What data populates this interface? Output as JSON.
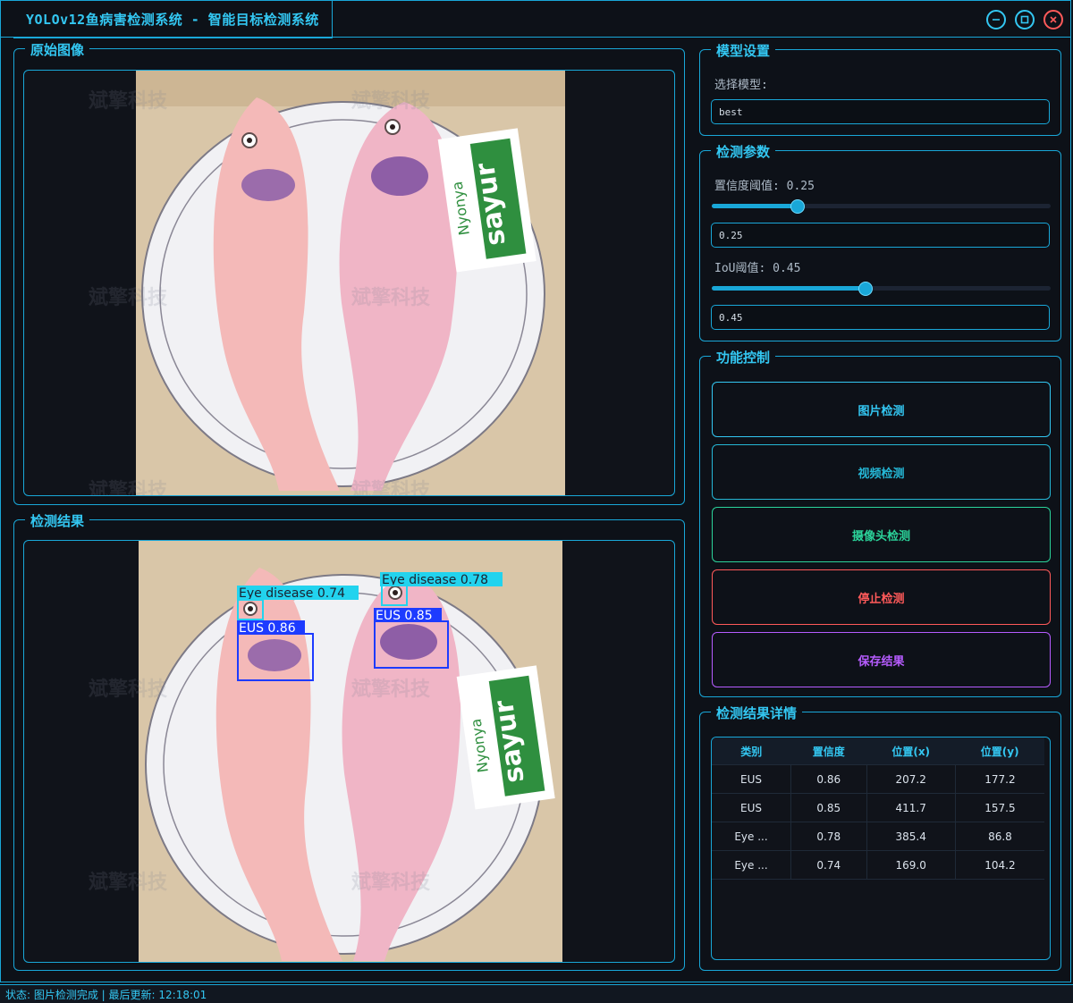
{
  "window": {
    "title": "YOLOv12鱼病害检测系统 - 智能目标检测系统"
  },
  "watermark": "斌擎科技",
  "original_panel": {
    "title": "原始图像"
  },
  "result_panel": {
    "title": "检测结果",
    "detections": [
      {
        "label": "Eye disease 0.74",
        "color": "#22d3ee"
      },
      {
        "label": "Eye disease 0.78",
        "color": "#22d3ee"
      },
      {
        "label": "EUS 0.86",
        "color": "#1d3bff"
      },
      {
        "label": "EUS 0.85",
        "color": "#1d3bff"
      }
    ]
  },
  "photo": {
    "brand_top": "Nyonya",
    "brand_bottom": "sayur"
  },
  "model_settings": {
    "title": "模型设置",
    "select_label": "选择模型:",
    "model_value": "best"
  },
  "detection_params": {
    "title": "检测参数",
    "confidence_label": "置信度阈值: 0.25",
    "confidence_value": "0.25",
    "confidence": 0.25,
    "iou_label": "IoU阈值: 0.45",
    "iou_value": "0.45",
    "iou": 0.45
  },
  "controls": {
    "title": "功能控制",
    "buttons": [
      {
        "label": "图片检测",
        "color": "#33c7f2"
      },
      {
        "label": "视频检测",
        "color": "#25b7d6"
      },
      {
        "label": "摄像头检测",
        "color": "#2bd39a"
      },
      {
        "label": "停止检测",
        "color": "#ff5a5a"
      },
      {
        "label": "保存结果",
        "color": "#b65cff"
      }
    ]
  },
  "details": {
    "title": "检测结果详情",
    "columns": [
      "类别",
      "置信度",
      "位置(x)",
      "位置(y)"
    ],
    "rows": [
      [
        "EUS",
        "0.86",
        "207.2",
        "177.2"
      ],
      [
        "EUS",
        "0.85",
        "411.7",
        "157.5"
      ],
      [
        "Eye ...",
        "0.78",
        "385.4",
        "86.8"
      ],
      [
        "Eye ...",
        "0.74",
        "169.0",
        "104.2"
      ]
    ]
  },
  "status": {
    "text": "状态: 图片检测完成 | 最后更新: 12:18:01"
  }
}
